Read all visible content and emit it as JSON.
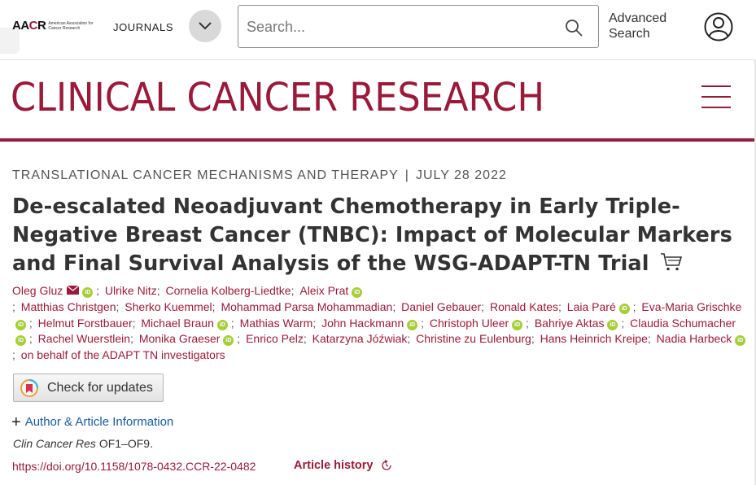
{
  "header": {
    "logo_text": "AACR",
    "logo_subtext": "American Association for Cancer Research",
    "journals_label": "JOURNALS",
    "search_placeholder": "Search...",
    "advanced_search_label": "Advanced Search",
    "icons": [
      "chevron-down-icon",
      "search-icon",
      "account-icon"
    ]
  },
  "journal": {
    "title": "CLINICAL CANCER RESEARCH",
    "brand_color": "#9a1a3a",
    "menu_icon": "hamburger-icon"
  },
  "article": {
    "section": "TRANSLATIONAL CANCER MECHANISMS AND THERAPY",
    "date": "JULY 28 2022",
    "title": "De-escalated Neoadjuvant Chemotherapy in Early Triple-Negative Breast Cancer (TNBC): Impact of Molecular Markers and Final Survival Analysis of the WSG-ADAPT-TN Trial",
    "authors": [
      {
        "name": "Oleg Gluz",
        "email": true,
        "orcid": true
      },
      {
        "name": "Ulrike Nitz",
        "orcid": false
      },
      {
        "name": "Cornelia Kolberg-Liedtke",
        "orcid": false
      },
      {
        "name": "Aleix Prat",
        "orcid": true
      },
      {
        "name": "Matthias Christgen",
        "orcid": false
      },
      {
        "name": "Sherko Kuemmel",
        "orcid": false
      },
      {
        "name": "Mohammad Parsa Mohammadian",
        "orcid": false
      },
      {
        "name": "Daniel Gebauer",
        "orcid": false
      },
      {
        "name": "Ronald Kates",
        "orcid": false
      },
      {
        "name": "Laia Paré",
        "orcid": true
      },
      {
        "name": "Eva-Maria Grischke",
        "orcid": true
      },
      {
        "name": "Helmut Forstbauer",
        "orcid": false
      },
      {
        "name": "Michael Braun",
        "orcid": true
      },
      {
        "name": "Mathias Warm",
        "orcid": false
      },
      {
        "name": "John Hackmann",
        "orcid": true
      },
      {
        "name": "Christoph Uleer",
        "orcid": true
      },
      {
        "name": "Bahriye Aktas",
        "orcid": true
      },
      {
        "name": "Claudia Schumacher",
        "orcid": true
      },
      {
        "name": "Rachel Wuerstlein",
        "orcid": false
      },
      {
        "name": "Monika Graeser",
        "orcid": true
      },
      {
        "name": "Enrico Pelz",
        "orcid": false
      },
      {
        "name": "Katarzyna Jóźwiak",
        "orcid": false
      },
      {
        "name": "Christine zu Eulenburg",
        "orcid": false
      },
      {
        "name": "Hans Heinrich Kreipe",
        "orcid": false
      },
      {
        "name": "Nadia Harbeck",
        "orcid": true
      },
      {
        "name": "on behalf of the ADAPT TN investigators",
        "orcid": false
      }
    ],
    "check_updates_label": "Check for updates",
    "author_info_label": "Author & Article Information",
    "citation_journal": "Clin Cancer Res",
    "citation_pages": "OF1–OF9.",
    "doi": "https://doi.org/10.1158/1078-0432.CCR-22-0482",
    "history_label": "Article history"
  }
}
